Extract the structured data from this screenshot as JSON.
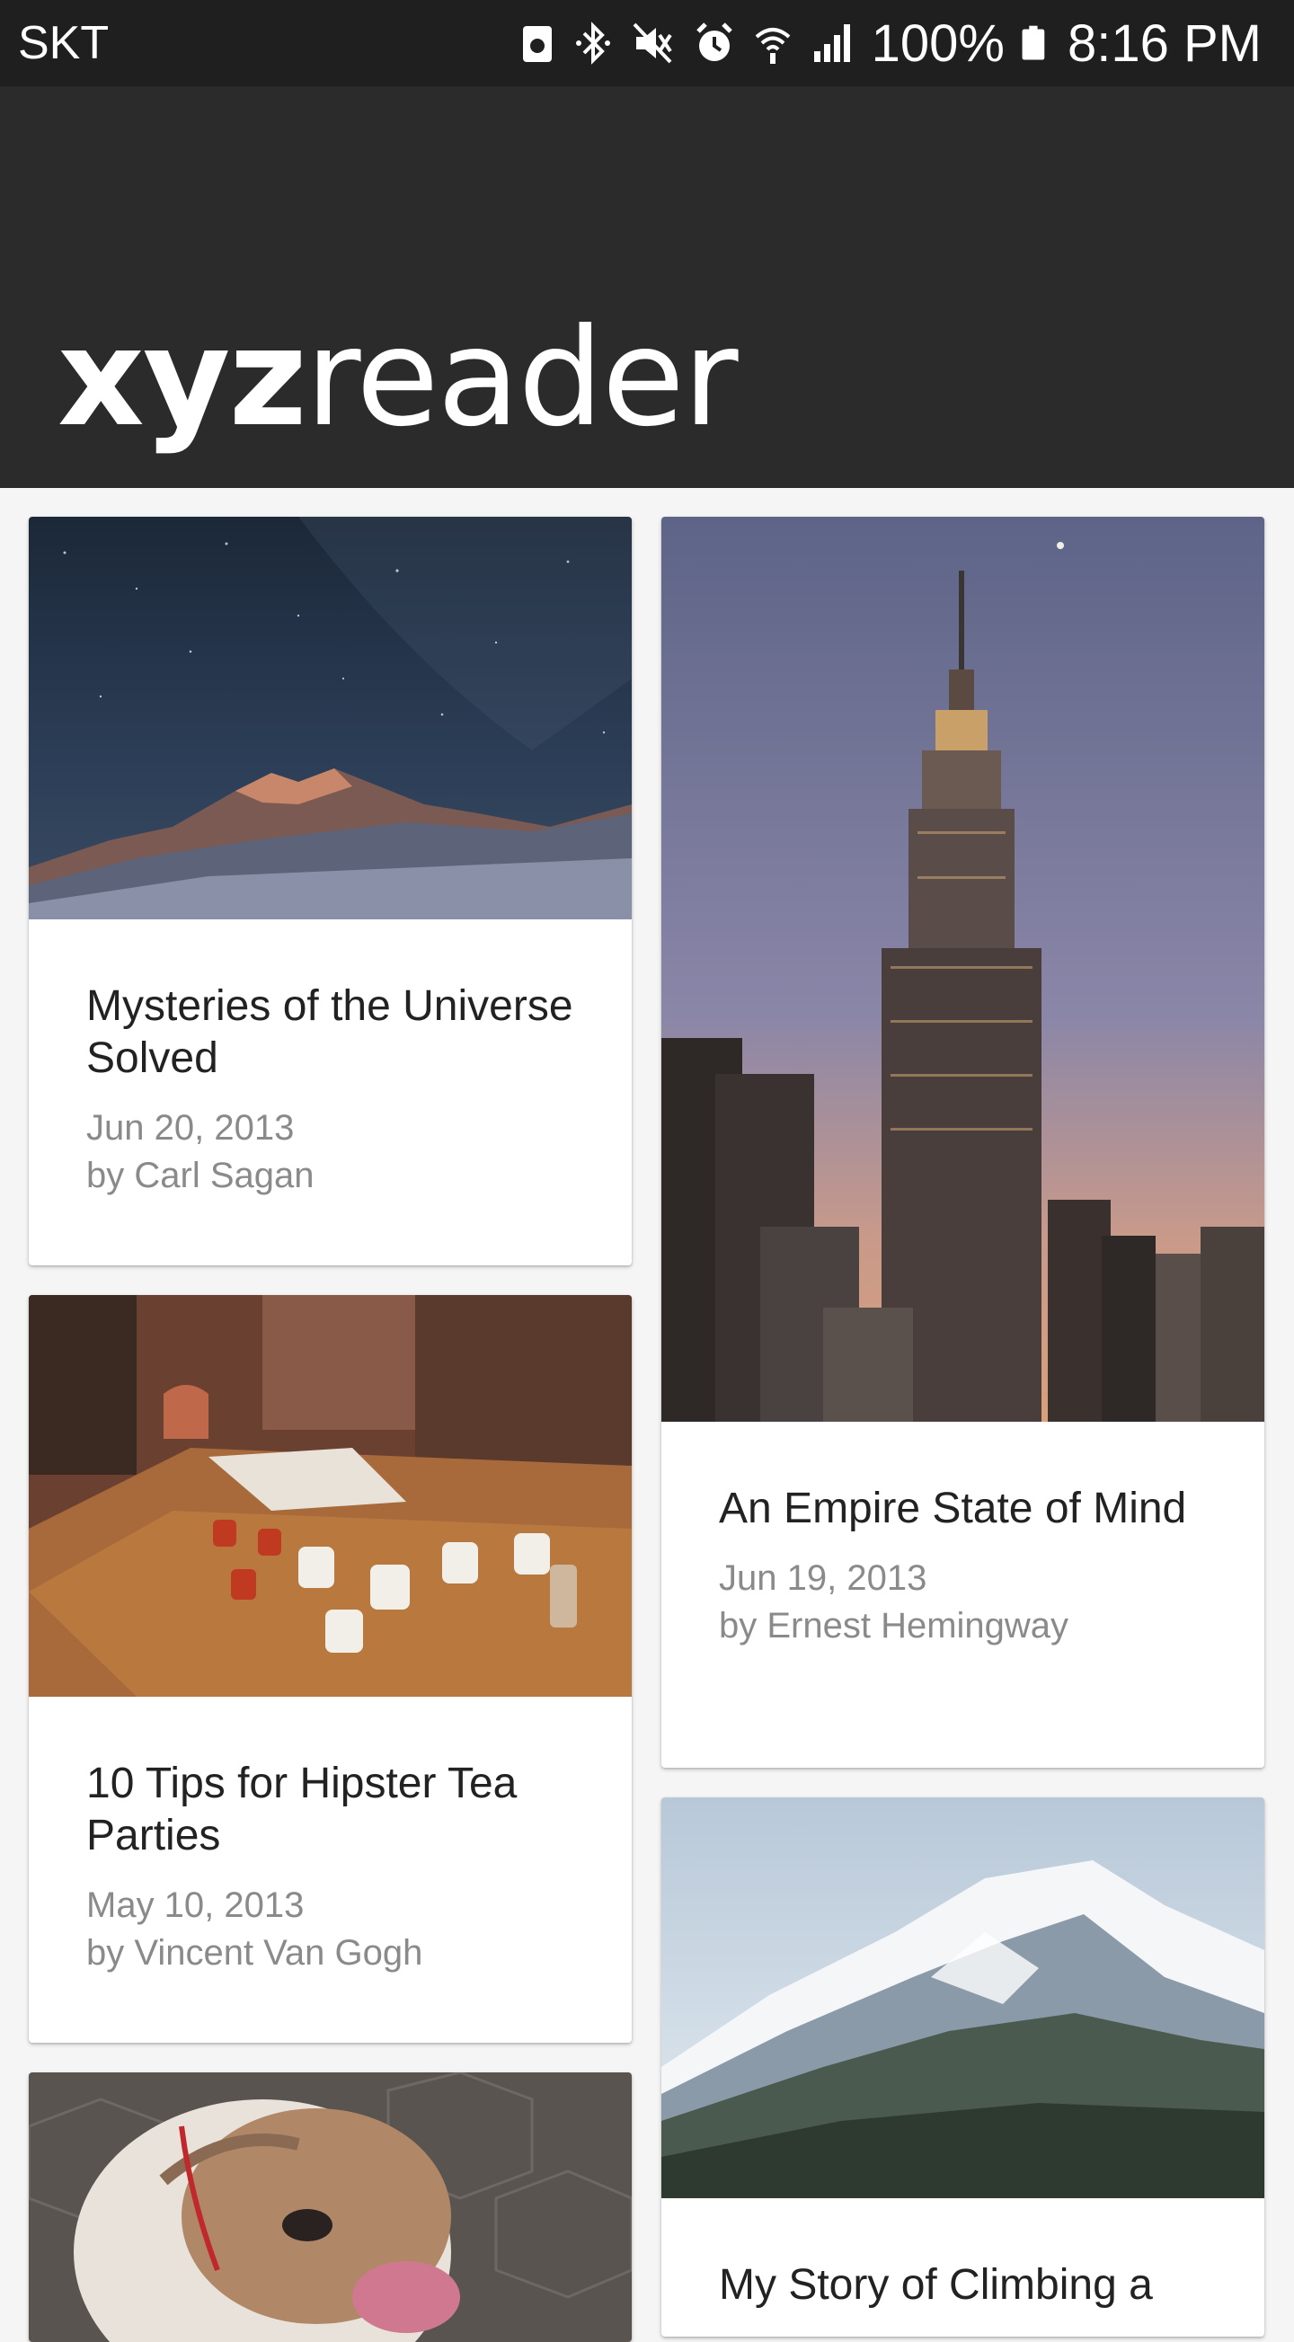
{
  "status_bar": {
    "carrier": "SKT",
    "battery": "100%",
    "time": "8:16 PM",
    "icons": [
      "recycle-icon",
      "bluetooth-icon",
      "mute-icon",
      "alarm-icon",
      "wifi-icon",
      "signal-icon",
      "battery-icon"
    ]
  },
  "app_bar": {
    "logo_part1": "xyz",
    "logo_part2": "reader",
    "background": "#2b2b2b"
  },
  "articles": [
    {
      "title": "Mysteries of the Universe Solved",
      "date": "Jun 20, 2013",
      "author": "by Carl Sagan",
      "image": "night-sky-mountain"
    },
    {
      "title": "An Empire State of Mind",
      "date": "Jun 19, 2013",
      "author": "by Ernest Hemingway",
      "image": "empire-state-building"
    },
    {
      "title": "10 Tips for Hipster Tea Parties",
      "date": "May 10, 2013",
      "author": "by Vincent Van Gogh",
      "image": "tea-cups-table"
    },
    {
      "title": "My Story of Climbing a",
      "image": "snowy-mountain"
    },
    {
      "image": "bulldog"
    }
  ]
}
